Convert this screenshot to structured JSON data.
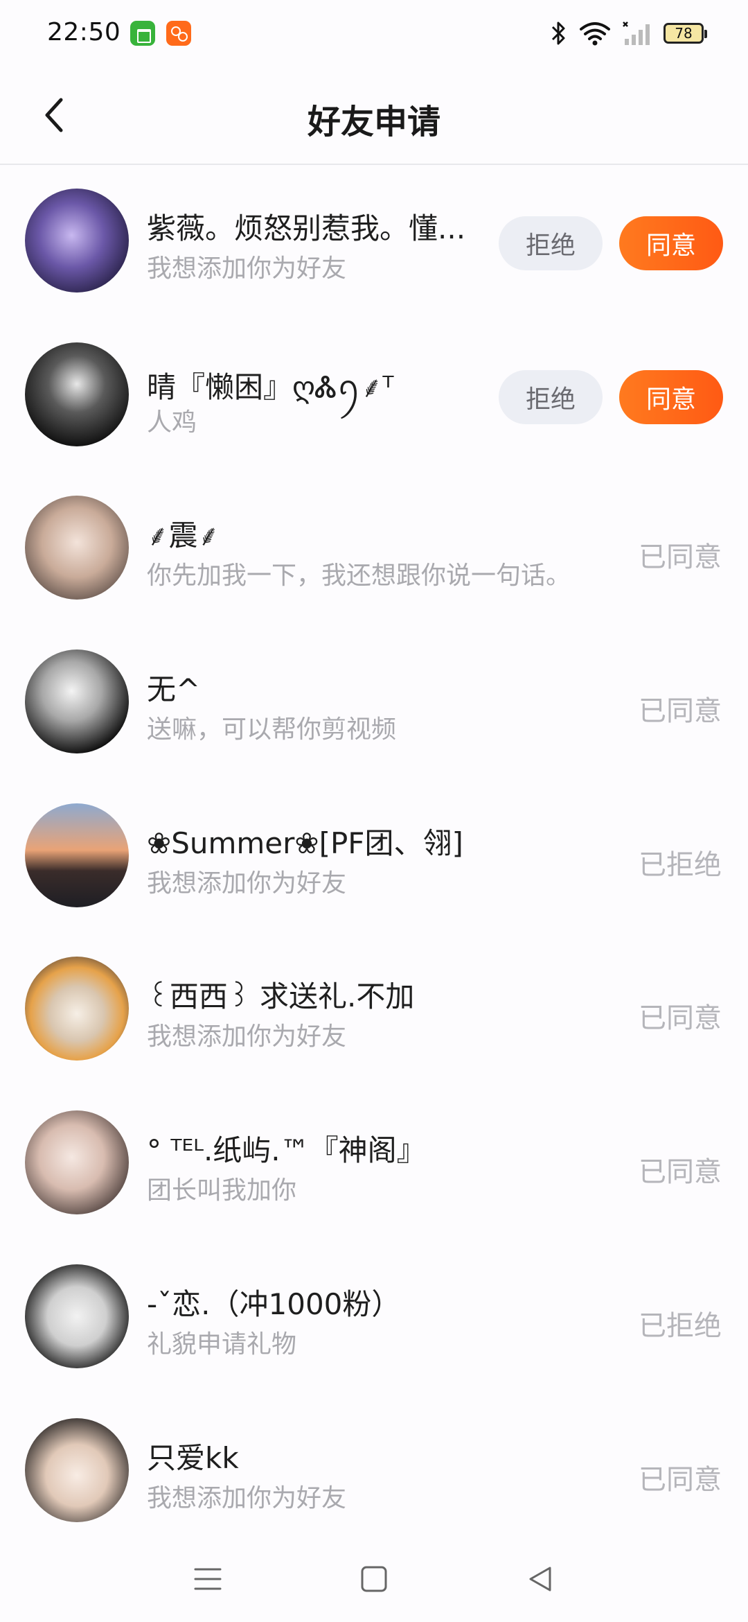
{
  "status_bar": {
    "time": "22:50",
    "battery": "78",
    "icons": [
      "bluetooth-icon",
      "wifi-icon",
      "signal-icon",
      "battery-icon"
    ]
  },
  "header": {
    "title": "好友申请",
    "back_icon": "chevron-left-icon"
  },
  "buttons": {
    "reject": "拒绝",
    "agree": "同意"
  },
  "requests": [
    {
      "name": "紫薇。烦怒别惹我。懂...",
      "message": "我想添加你为好友",
      "state": "pending"
    },
    {
      "name": "晴『懒困』ღᏜꪆ⸙ᵀ",
      "message": "人鸡",
      "state": "pending"
    },
    {
      "name": "⸙震⸙",
      "message": "你先加我一下，我还想跟你说一句话。",
      "status": "已同意"
    },
    {
      "name": "无^",
      "message": "送嘛，可以帮你剪视频",
      "status": "已同意"
    },
    {
      "name": "❀Summer❀[PF团、翎]",
      "message": "我想添加你为好友",
      "status": "已拒绝"
    },
    {
      "name": "꒰西西꒱ 求送礼.不加",
      "message": "我想添加你为好友",
      "status": "已同意"
    },
    {
      "name": "° ᵀᴱᴸ.纸屿.™『神阁』",
      "message": "团长叫我加你",
      "status": "已同意"
    },
    {
      "name": "-ˇ恋.（冲1000粉）",
      "message": "礼貌申请礼物",
      "status": "已拒绝"
    },
    {
      "name": "只爱kk",
      "message": "我想添加你为好友",
      "status": "已同意"
    }
  ],
  "colors": {
    "accent": "#ff6a1a",
    "muted": "#b5b5ba",
    "reject_bg": "#eceef4"
  }
}
